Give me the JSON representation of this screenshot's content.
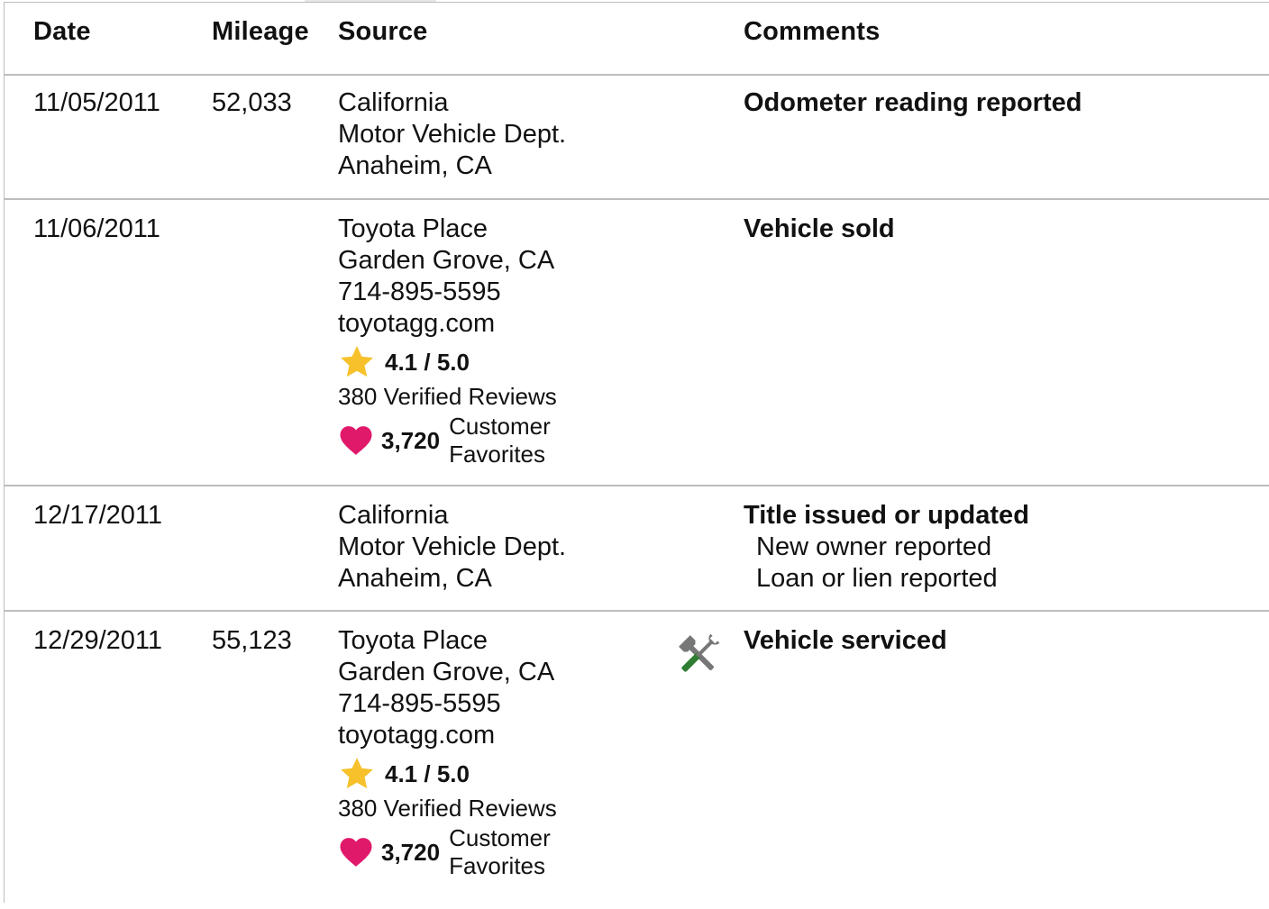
{
  "headers": {
    "date": "Date",
    "mileage": "Mileage",
    "source": "Source",
    "comments": "Comments"
  },
  "rows": [
    {
      "date": "11/05/2011",
      "mileage": "52,033",
      "source": [
        "California",
        "Motor Vehicle Dept.",
        "Anaheim, CA"
      ],
      "comment_main": "Odometer reading reported",
      "comment_sub": []
    },
    {
      "date": "11/06/2011",
      "mileage": "",
      "source": [
        "Toyota Place",
        "Garden Grove, CA",
        "714-895-5595",
        "toyotagg.com"
      ],
      "rating": "4.1 / 5.0",
      "reviews": "380 Verified Reviews",
      "favorites_count": "3,720",
      "favorites_label": "Customer Favorites",
      "comment_main": "Vehicle sold",
      "comment_sub": []
    },
    {
      "date": "12/17/2011",
      "mileage": "",
      "source": [
        "California",
        "Motor Vehicle Dept.",
        "Anaheim, CA"
      ],
      "comment_main": "Title issued or updated",
      "comment_sub": [
        "New owner reported",
        "Loan or lien reported"
      ]
    },
    {
      "date": "12/29/2011",
      "mileage": "55,123",
      "source": [
        "Toyota Place",
        "Garden Grove, CA",
        "714-895-5595",
        "toyotagg.com"
      ],
      "rating": "4.1 / 5.0",
      "reviews": "380 Verified Reviews",
      "favorites_count": "3,720",
      "favorites_label": "Customer Favorites",
      "comment_main": "Vehicle serviced",
      "comment_sub": [],
      "icon": "tools-icon"
    }
  ],
  "colors": {
    "star": "#f6c12b",
    "heart": "#e0196a",
    "tool_gray": "#777777",
    "tool_green": "#2e7d32",
    "divider": "#bdbdbd"
  },
  "icons": {
    "rating": "star-icon",
    "favorites": "heart-icon",
    "service": "tools-icon"
  }
}
